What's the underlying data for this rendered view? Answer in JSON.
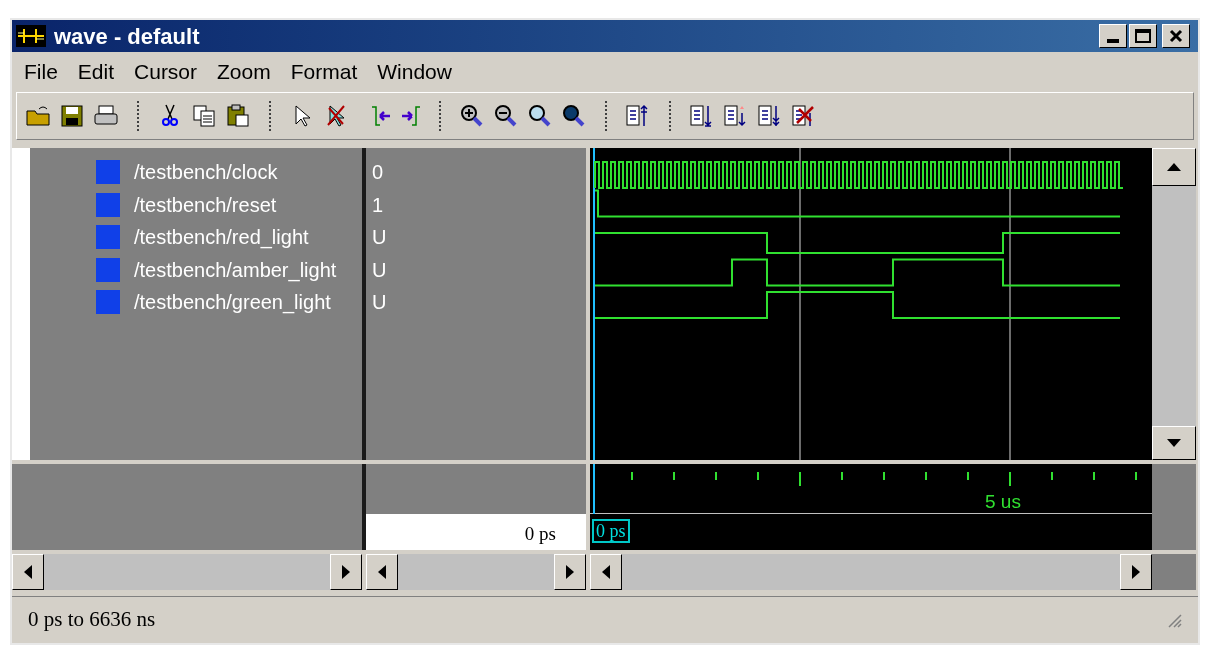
{
  "window": {
    "title": "wave - default"
  },
  "menu": [
    "File",
    "Edit",
    "Cursor",
    "Zoom",
    "Format",
    "Window"
  ],
  "signals": [
    {
      "name": "/testbench/clock",
      "value": "0",
      "kind": "clock"
    },
    {
      "name": "/testbench/reset",
      "value": "1",
      "kind": "reset"
    },
    {
      "name": "/testbench/red_light",
      "value": "U",
      "kind": "red"
    },
    {
      "name": "/testbench/amber_light",
      "value": "U",
      "kind": "amber"
    },
    {
      "name": "/testbench/green_light",
      "value": "U",
      "kind": "green"
    }
  ],
  "timeline": {
    "tick_label": "5 us",
    "cursor_time": "0 ps",
    "cursor_value_time": "0 ps"
  },
  "status_bar": "0 ps to 6636 ns"
}
